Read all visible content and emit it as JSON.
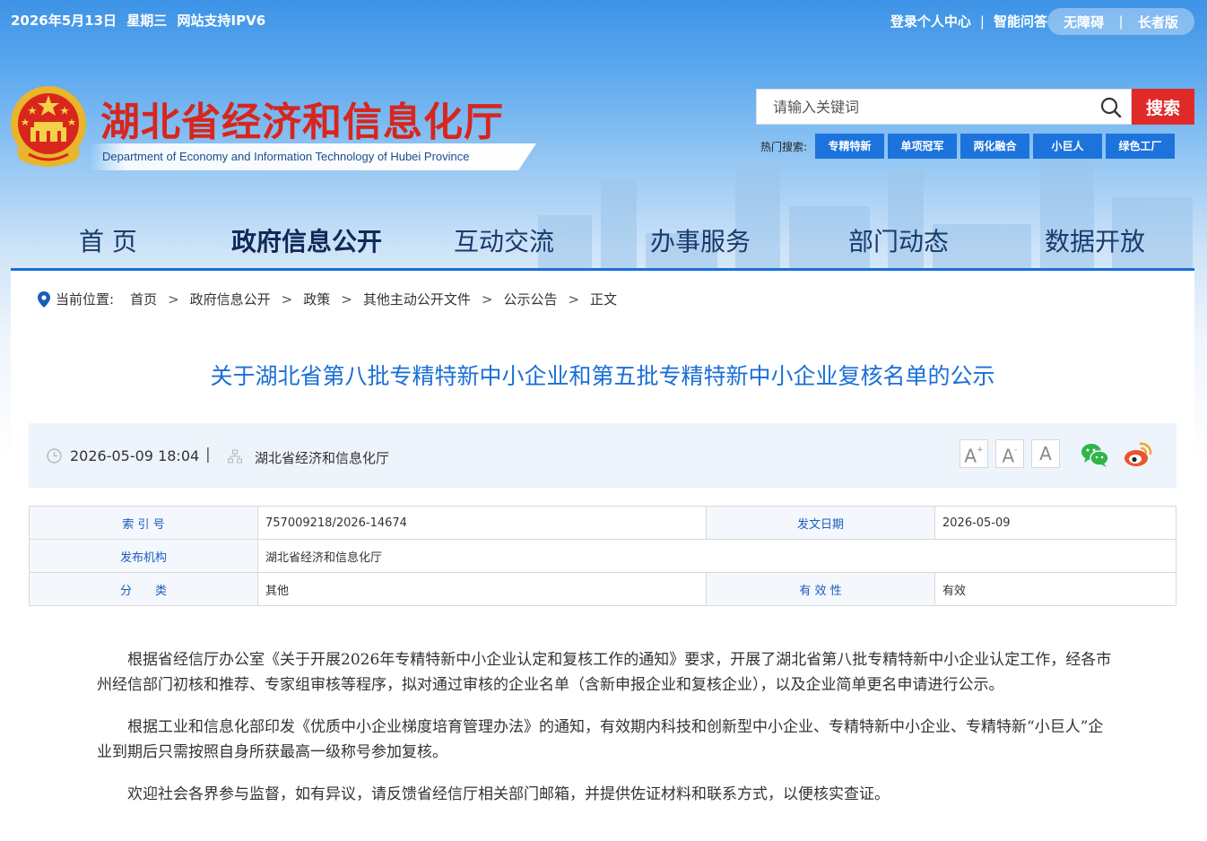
{
  "topbar": {
    "date": "2026年5月13日",
    "weekday": "星期三",
    "ipv6": "网站支持IPV6",
    "login": "登录个人中心",
    "qa": "智能问答",
    "accessible": "无障碍",
    "elder": "长者版"
  },
  "header": {
    "title": "湖北省经济和信息化厅",
    "subtitle": "Department of Economy and Information Technology of Hubei Province",
    "search_placeholder": "请输入关键词",
    "search_button": "搜索",
    "hot_label": "热门搜索:",
    "hot_tags": [
      "专精特新",
      "单项冠军",
      "两化融合",
      "小巨人",
      "绿色工厂"
    ]
  },
  "nav": [
    "首 页",
    "政府信息公开",
    "互动交流",
    "办事服务",
    "部门动态",
    "数据开放"
  ],
  "breadcrumb": {
    "label": "当前位置:",
    "items": [
      "首页",
      "政府信息公开",
      "政策",
      "其他主动公开文件",
      "公示公告",
      "正文"
    ],
    "separator": ">"
  },
  "article": {
    "title": "关于湖北省第八批专精特新中小企业和第五批专精特新中小企业复核名单的公示",
    "datetime": "2026-05-09 18:04",
    "meta_sep": "|",
    "source": "湖北省经济和信息化厅",
    "font_buttons": [
      "A",
      "A",
      "A"
    ],
    "font_sup": [
      "+",
      "-"
    ]
  },
  "info_table": {
    "index_label": "索 引 号",
    "index_value": "757009218/2026-14674",
    "date_label": "发文日期",
    "date_value": "2026-05-09",
    "org_label": "发布机构",
    "org_value": "湖北省经济和信息化厅",
    "category_label": "分　　类",
    "category_value": "其他",
    "validity_label": "有 效 性",
    "validity_value": "有效"
  },
  "body": [
    "根据省经信厅办公室《关于开展2026年专精特新中小企业认定和复核工作的通知》要求，开展了湖北省第八批专精特新中小企业认定工作，经各市州经信部门初核和推荐、专家组审核等程序，拟对通过审核的企业名单（含新申报企业和复核企业），以及企业简单更名申请进行公示。",
    "根据工业和信息化部印发《优质中小企业梯度培育管理办法》的通知，有效期内科技和创新型中小企业、专精特新中小企业、专精特新“小巨人”企业到期后只需按照自身所获最高一级称号参加复核。",
    "欢迎社会各界参与监督，如有异议，请反馈省经信厅相关部门邮箱，并提供佐证材料和联系方式，以便核实查证。"
  ],
  "colors": {
    "brand_red": "#d7261e",
    "link_blue": "#1a6fd6",
    "tag_blue": "#1c73dc",
    "search_red": "#e02a2a"
  },
  "icons": [
    "national-emblem-icon",
    "search-icon",
    "location-pin-icon",
    "clock-icon",
    "org-icon",
    "wechat-icon",
    "weibo-icon"
  ]
}
